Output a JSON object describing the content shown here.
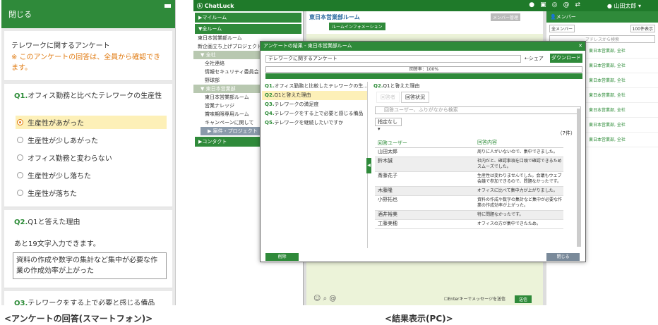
{
  "phone": {
    "close_label": "閉じる",
    "survey_title": "テレワークに関するアンケート",
    "notice": "※ このアンケートの回答は、全員から確認できます。",
    "q1": {
      "num": "Q1.",
      "text": "オフィス勤務と比べたテレワークの生産性",
      "options": [
        "生産性があがった",
        "生産性が少しあがった",
        "オフィス勤務と変わらない",
        "生産性が少し落ちた",
        "生産性が落ちた"
      ]
    },
    "q2": {
      "num": "Q2.",
      "text": "Q1と答えた理由",
      "remaining": "あと19文字入力できます。",
      "answer": "資料の作成や数字の集計など集中が必要な作業の作成効率が上がった"
    },
    "q3": {
      "num": "Q3.",
      "text": "テレワークをする上で必要と感じる備品"
    }
  },
  "pc": {
    "app_name": "ChatLuck",
    "user_name": "山田太郎",
    "left": {
      "myroom": "マイルーム",
      "all_rooms": "全ルーム",
      "items": [
        "東日本営業部ルーム",
        "新企画立ち上げプロジェクト"
      ],
      "group_all": "全社",
      "all_items": [
        "全社連絡",
        "情報セキュリティ委員会",
        "野球部"
      ],
      "group_east": "東日本営業部",
      "east_items": [
        "東日本営業部ルーム",
        "営業ナレッジ",
        "賞味期限専用ルーム",
        "キャンペーンに関して"
      ],
      "group_project": "案件・プロジェクト",
      "contact": "コンタクト"
    },
    "center": {
      "room_title": "東日本営業部ルーム",
      "room_info": "ルームインフォメーション",
      "member_manage": "メンバー管理",
      "enter_send": "Enterキーでメッセージを送信",
      "send": "送信"
    },
    "right": {
      "title": "メンバー",
      "filter": "全メンバー",
      "per_page": "100件表示",
      "search_placeholder": "アドレスから検索",
      "dept": "東日本営業部, 全社"
    },
    "modal": {
      "title": "アンケートの結果 - 東日本営業部ルーム",
      "survey_name": "テレワークに関するアンケート",
      "share": "シェア",
      "download": "ダウンロード",
      "response_rate": "回答率：100%",
      "response_rate_value": 100,
      "questions": [
        {
          "num": "Q1.",
          "text": "オフィス勤務と比較したテレワークの生..."
        },
        {
          "num": "Q2.",
          "text": "Q1と答えた理由"
        },
        {
          "num": "Q3.",
          "text": "テレワークの満足度"
        },
        {
          "num": "Q4.",
          "text": "テレワークをする上で必要と感じる備品"
        },
        {
          "num": "Q5.",
          "text": "テレワークを継続したいですか"
        }
      ],
      "detail_title": "Q2.Q1と答えた理由",
      "tab_inactive": "回答者",
      "tab_status": "回答状況",
      "search_placeholder": "回答ユーザー、ふりがなから検索",
      "filter_value": "指定なし",
      "count": "（7件）",
      "col_user": "回答ユーザー",
      "col_content": "回答内容",
      "rows": [
        {
          "user": "山田太郎",
          "content": "周りに人がいないので、集中できました。"
        },
        {
          "user": "鈴木誠",
          "content": "社内だと、確認事項を口頭で確認できるためスムーズでした。"
        },
        {
          "user": "斎藤花子",
          "content": "生産性は変わりませんでした。会議もウェブ会議で参加できるので、問題なかったです。"
        },
        {
          "user": "木藤隆",
          "content": "オフィスに比べて集中力が上がりました。"
        },
        {
          "user": "小野拓也",
          "content": "資料の作成や数字の集計など集中が必要な作業の作成効率が上がった。"
        },
        {
          "user": "酒井裕美",
          "content": "特に問題なかったです。"
        },
        {
          "user": "工藤美穂",
          "content": "オフィスの方が集中できたため。"
        }
      ],
      "delete": "削除",
      "close": "閉じる"
    }
  },
  "captions": {
    "left": "<アンケートの回答(スマートフォン)>",
    "right": "<結果表示(PC)>"
  },
  "colors": {
    "brand": "#2f8a3a",
    "highlight": "#fdf0b8",
    "notice": "#e07a10"
  }
}
